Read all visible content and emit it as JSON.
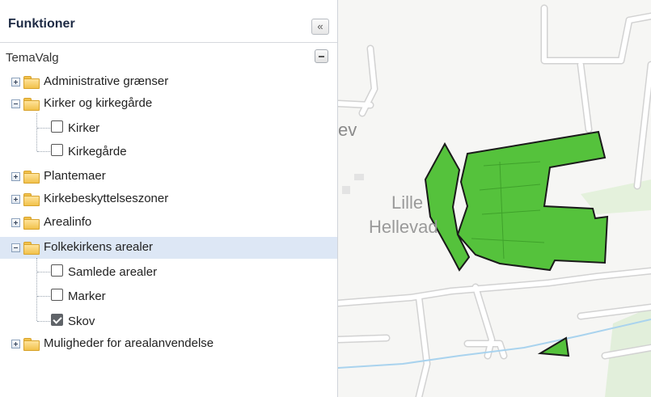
{
  "panel": {
    "title": "Funktioner",
    "collapse_glyph": "«"
  },
  "section": {
    "title": "TemaValg"
  },
  "tree": [
    {
      "label": "Administrative grænser",
      "expanded": false
    },
    {
      "label": "Kirker og kirkegårde",
      "expanded": true
    },
    {
      "label": "Kirker",
      "checked": false
    },
    {
      "label": "Kirkegårde",
      "checked": false
    },
    {
      "label": "Plantemaer",
      "expanded": false
    },
    {
      "label": "Kirkebeskyttelseszoner",
      "expanded": false
    },
    {
      "label": "Arealinfo",
      "expanded": false
    },
    {
      "label": "Folkekirkens arealer",
      "expanded": true,
      "selected": true
    },
    {
      "label": "Samlede arealer",
      "checked": false
    },
    {
      "label": "Marker",
      "checked": false
    },
    {
      "label": "Skov",
      "checked": true
    },
    {
      "label": "Muligheder for arealanvendelse",
      "expanded": false
    }
  ],
  "map": {
    "labels": [
      "ev",
      "Lille",
      "Hellevad"
    ],
    "colors": {
      "polygon_fill": "#55c23c",
      "polygon_stroke": "#1a1a1a",
      "road": "#ffffff",
      "stream": "#a9d3ee"
    }
  }
}
